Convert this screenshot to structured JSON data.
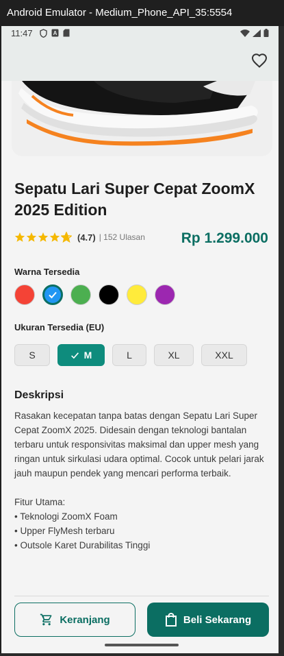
{
  "window": {
    "title": "Android Emulator - Medium_Phone_API_35:5554"
  },
  "status_bar": {
    "time": "11:47"
  },
  "appbar": {
    "favorite_icon": "heart-outline-icon"
  },
  "product": {
    "name": "Sepatu Lari Super Cepat ZoomX 2025 Edition",
    "rating": 4.7,
    "rating_text": "(4.7)",
    "reviews_text": "| 152 Ulasan",
    "price": "Rp 1.299.000"
  },
  "colors": {
    "label": "Warna Tersedia",
    "options": [
      "#f44336",
      "#2196f3",
      "#4caf50",
      "#000000",
      "#ffeb3b",
      "#9c27b0"
    ],
    "selected_index": 1
  },
  "sizes": {
    "label": "Ukuran Tersedia (EU)",
    "options": [
      "S",
      "M",
      "L",
      "XL",
      "XXL"
    ],
    "selected": "M"
  },
  "description": {
    "title": "Deskripsi",
    "text": "Rasakan kecepatan tanpa batas dengan Sepatu Lari Super Cepat ZoomX 2025. Didesain dengan teknologi bantalan terbaru untuk responsivitas maksimal dan upper mesh yang ringan untuk sirkulasi udara optimal. Cocok untuk pelari jarak jauh maupun pendek yang mencari performa terbaik.\n\nFitur Utama:\n• Teknologi ZoomX Foam\n• Upper FlyMesh terbaru\n• Outsole Karet Durabilitas Tinggi"
  },
  "actions": {
    "cart_label": "Keranjang",
    "buy_label": "Beli Sekarang"
  },
  "theme": {
    "accent": "#0b6e62",
    "star": "#f5b800"
  }
}
